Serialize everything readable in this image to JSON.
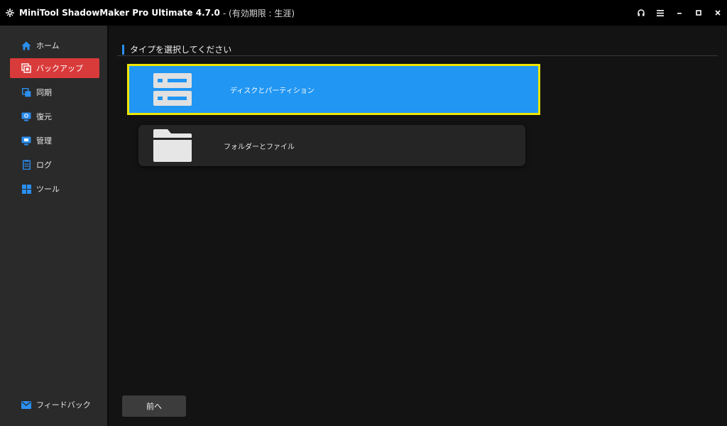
{
  "window": {
    "title": "MiniTool ShadowMaker Pro Ultimate 4.7.0",
    "subtitle": "- (有効期限 : 生涯)",
    "controls": [
      "headset-icon",
      "menu-icon",
      "minimize-icon",
      "maximize-icon",
      "close-icon"
    ]
  },
  "sidebar": {
    "items": [
      {
        "label": "ホーム",
        "icon": "home-icon",
        "active": false
      },
      {
        "label": "バックアップ",
        "icon": "backup-icon",
        "active": true
      },
      {
        "label": "同期",
        "icon": "sync-icon",
        "active": false
      },
      {
        "label": "復元",
        "icon": "restore-icon",
        "active": false
      },
      {
        "label": "管理",
        "icon": "manage-icon",
        "active": false
      },
      {
        "label": "ログ",
        "icon": "log-icon",
        "active": false
      },
      {
        "label": "ツール",
        "icon": "tools-icon",
        "active": false
      }
    ],
    "feedback": {
      "label": "フィードバック",
      "icon": "mail-icon"
    }
  },
  "main": {
    "section_title": "タイプを選択してください",
    "options": [
      {
        "label": "ディスクとパーティション",
        "icon": "disk-icon",
        "selected": true
      },
      {
        "label": "フォルダーとファイル",
        "icon": "folder-icon",
        "selected": false
      }
    ],
    "back_label": "前へ"
  },
  "colors": {
    "accent_blue": "#2196f3",
    "active_red": "#d93a3a",
    "highlight_yellow": "#f2e600",
    "icon_blue": "#2b8ff0"
  }
}
